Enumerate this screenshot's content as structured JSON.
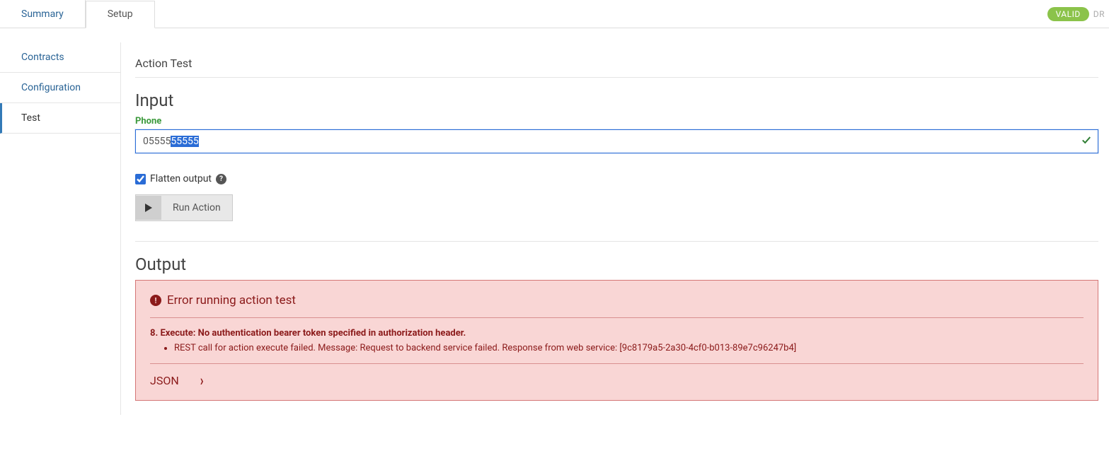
{
  "topTabs": {
    "summary": "Summary",
    "setup": "Setup"
  },
  "badges": {
    "valid": "VALID",
    "dr": "DR"
  },
  "sidebar": {
    "contracts": "Contracts",
    "configuration": "Configuration",
    "test": "Test"
  },
  "page": {
    "title": "Action Test",
    "input_heading": "Input",
    "output_heading": "Output"
  },
  "form": {
    "phone_label": "Phone",
    "phone_value_prefix": "05555",
    "phone_value_selected": "55555",
    "flatten_label": "Flatten output",
    "run_label": "Run Action"
  },
  "error": {
    "title": "Error running action test",
    "step": "8. Execute: No authentication bearer token specified in authorization header.",
    "detail": "REST call for action execute failed. Message: Request to backend service failed. Response from web service: [9c8179a5-2a30-4cf0-b013-89e7c96247b4]",
    "json_label": "JSON"
  }
}
